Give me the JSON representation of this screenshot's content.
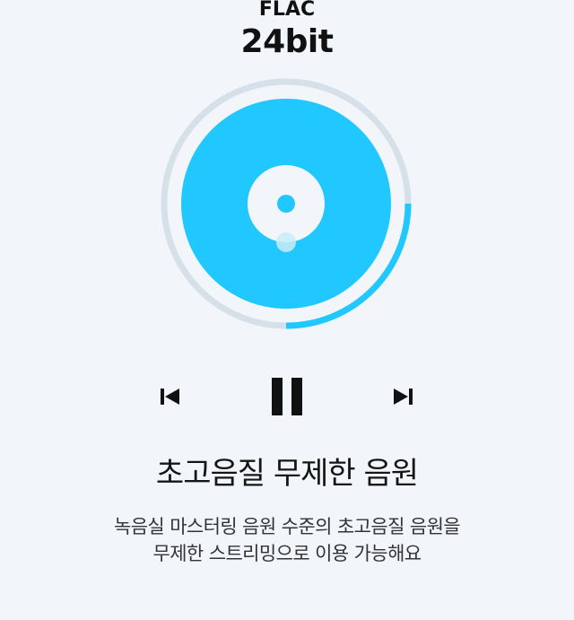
{
  "format": {
    "codec": "FLAC",
    "bit_depth": "24bit"
  },
  "player": {
    "progress": 0.25,
    "colors": {
      "disc": "#20c8ff",
      "track_ring": "#d6e0e8",
      "progress_ring": "#20c8ff",
      "label": "#f2f6fa",
      "background": "#f2f6fa"
    },
    "controls": {
      "previous_icon": "skip-previous-icon",
      "pause_icon": "pause-icon",
      "next_icon": "skip-next-icon"
    }
  },
  "headline": "초고음질 무제한 음원",
  "description": {
    "line1": "녹음실 마스터링 음원 수준의 초고음질 음원을",
    "line2": "무제한 스트리밍으로 이용 가능해요"
  }
}
